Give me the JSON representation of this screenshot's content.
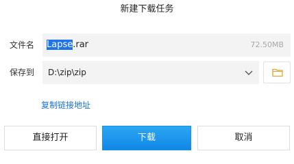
{
  "dialog": {
    "title": "新建下载任务"
  },
  "filename": {
    "label": "文件名",
    "selected_part": "Lapse",
    "rest_part": ".rar",
    "size": "72.50MB"
  },
  "save_to": {
    "label": "保存到",
    "path": "D:\\zip\\zip",
    "dropdown_icon": "chevron-down-icon",
    "browse_icon": "folder-icon"
  },
  "copy_link_label": "复制链接地址",
  "buttons": {
    "open_directly": "直接打开",
    "download": "下载",
    "cancel": "取消"
  },
  "colors": {
    "accent": "#1287e6",
    "link": "#1a73d9",
    "selection": "#1e73e8",
    "folder": "#f2c14e"
  }
}
